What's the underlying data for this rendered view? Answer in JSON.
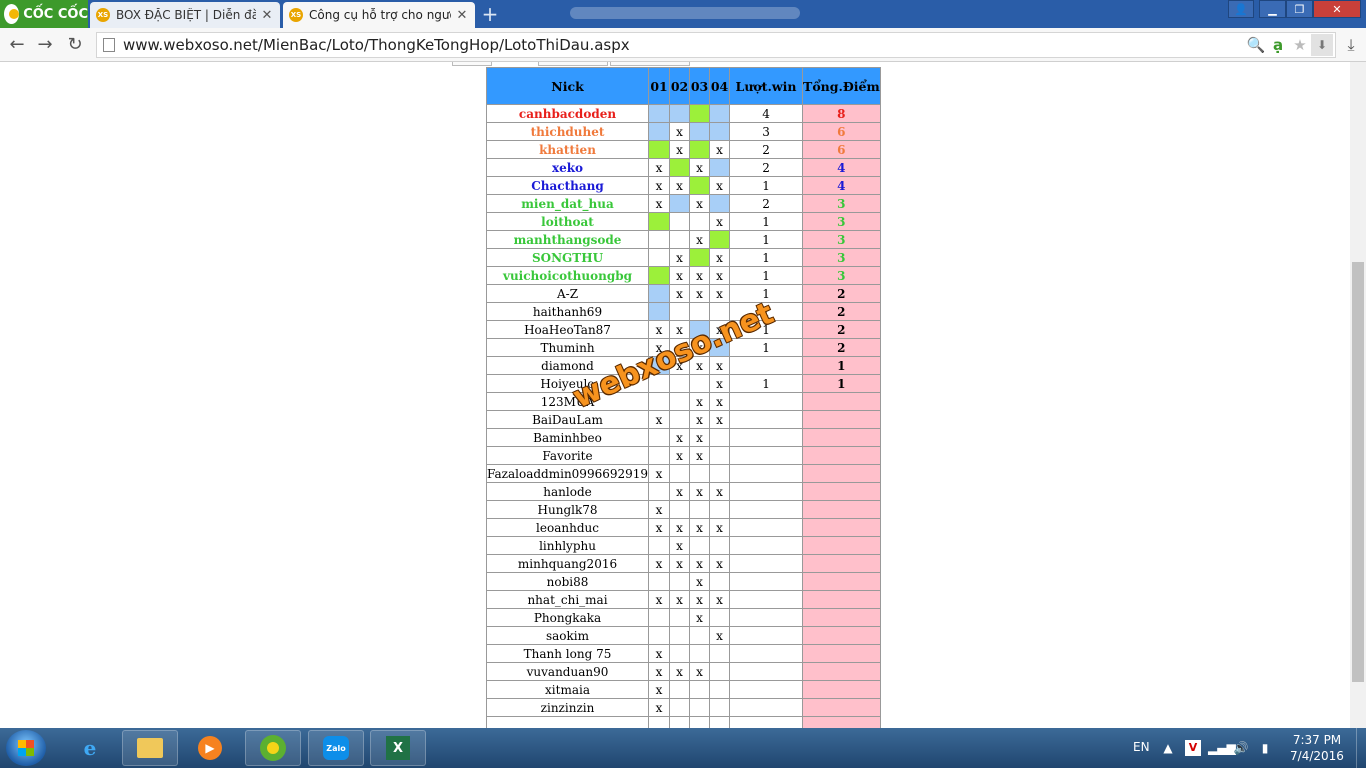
{
  "browser": {
    "brand": "CỐC CỐC",
    "tabs": [
      {
        "favicon": "XS",
        "title": "BOX ĐẶC BIỆT | Diễn đàn x",
        "active": false
      },
      {
        "favicon": "XS",
        "title": "Công cụ hỗ trợ cho người",
        "active": true
      }
    ],
    "url": "www.webxoso.net/MienBac/Loto/ThongKeTongHop/LotoThiDau.aspx"
  },
  "table": {
    "headers": [
      "Nick",
      "01",
      "02",
      "03",
      "04",
      "Lượt.win",
      "Tổng.Điểm"
    ],
    "rows": [
      {
        "nick": "canhbacdoden",
        "style": "red",
        "c": [
          "blue",
          "blue",
          "green",
          "blue"
        ],
        "wins": "4",
        "points": "8"
      },
      {
        "nick": "thichduhet",
        "style": "orange",
        "c": [
          "blue",
          "x",
          "blue",
          "blue"
        ],
        "wins": "3",
        "points": "6"
      },
      {
        "nick": "khattien",
        "style": "orange",
        "c": [
          "green",
          "x",
          "green",
          "x"
        ],
        "wins": "2",
        "points": "6"
      },
      {
        "nick": "xeko",
        "style": "navy",
        "c": [
          "x",
          "green",
          "x",
          "blue"
        ],
        "wins": "2",
        "points": "4"
      },
      {
        "nick": "Chacthang",
        "style": "navy",
        "c": [
          "x",
          "x",
          "green",
          "x"
        ],
        "wins": "1",
        "points": "4"
      },
      {
        "nick": "mien_dat_hua",
        "style": "lime",
        "c": [
          "x",
          "blue",
          "x",
          "blue"
        ],
        "wins": "2",
        "points": "3"
      },
      {
        "nick": "loithoat",
        "style": "lime",
        "c": [
          "green",
          "",
          "",
          "x"
        ],
        "wins": "1",
        "points": "3"
      },
      {
        "nick": "manhthangsode",
        "style": "lime",
        "c": [
          "",
          "",
          "x",
          "green"
        ],
        "wins": "1",
        "points": "3"
      },
      {
        "nick": "SONGTHU",
        "style": "lime",
        "c": [
          "",
          "x",
          "green",
          "x"
        ],
        "wins": "1",
        "points": "3"
      },
      {
        "nick": "vuichoicothuongbg",
        "style": "lime",
        "c": [
          "green",
          "x",
          "x",
          "x"
        ],
        "wins": "1",
        "points": "3"
      },
      {
        "nick": "A-Z",
        "style": "",
        "c": [
          "blue",
          "x",
          "x",
          "x"
        ],
        "wins": "1",
        "points": "2"
      },
      {
        "nick": "haithanh69",
        "style": "",
        "c": [
          "blue",
          "",
          "",
          ""
        ],
        "wins": "1",
        "points": "2"
      },
      {
        "nick": "HoaHeoTan87",
        "style": "",
        "c": [
          "x",
          "x",
          "blue",
          "x"
        ],
        "wins": "1",
        "points": "2"
      },
      {
        "nick": "Thuminh",
        "style": "",
        "c": [
          "x",
          "x",
          "x",
          "blue"
        ],
        "wins": "1",
        "points": "2"
      },
      {
        "nick": "diamond",
        "style": "",
        "c": [
          "blue",
          "x",
          "x",
          "x"
        ],
        "wins": "",
        "points": "1"
      },
      {
        "nick": "Hoiyeulo",
        "style": "",
        "c": [
          "",
          "",
          "",
          "x"
        ],
        "wins": "1",
        "points": "1"
      },
      {
        "nick": "123MUA",
        "style": "",
        "c": [
          "",
          "",
          "x",
          "x"
        ],
        "wins": "",
        "points": ""
      },
      {
        "nick": "BaiDauLam",
        "style": "",
        "c": [
          "x",
          "",
          "x",
          "x"
        ],
        "wins": "",
        "points": ""
      },
      {
        "nick": "Baminhbeo",
        "style": "",
        "c": [
          "",
          "x",
          "x",
          ""
        ],
        "wins": "",
        "points": ""
      },
      {
        "nick": "Favorite",
        "style": "",
        "c": [
          "",
          "x",
          "x",
          ""
        ],
        "wins": "",
        "points": ""
      },
      {
        "nick": "Fazaloaddmin0996692919",
        "style": "",
        "c": [
          "x",
          "",
          "",
          ""
        ],
        "wins": "",
        "points": ""
      },
      {
        "nick": "hanlode",
        "style": "",
        "c": [
          "",
          "x",
          "x",
          "x"
        ],
        "wins": "",
        "points": ""
      },
      {
        "nick": "Hunglk78",
        "style": "",
        "c": [
          "x",
          "",
          "",
          ""
        ],
        "wins": "",
        "points": ""
      },
      {
        "nick": "leoanhduc",
        "style": "",
        "c": [
          "x",
          "x",
          "x",
          "x"
        ],
        "wins": "",
        "points": ""
      },
      {
        "nick": "linhlyphu",
        "style": "",
        "c": [
          "",
          "x",
          "",
          ""
        ],
        "wins": "",
        "points": ""
      },
      {
        "nick": "minhquang2016",
        "style": "",
        "c": [
          "x",
          "x",
          "x",
          "x"
        ],
        "wins": "",
        "points": ""
      },
      {
        "nick": "nobi88",
        "style": "",
        "c": [
          "",
          "",
          "x",
          ""
        ],
        "wins": "",
        "points": ""
      },
      {
        "nick": "nhat_chi_mai",
        "style": "",
        "c": [
          "x",
          "x",
          "x",
          "x"
        ],
        "wins": "",
        "points": ""
      },
      {
        "nick": "Phongkaka",
        "style": "",
        "c": [
          "",
          "",
          "x",
          ""
        ],
        "wins": "",
        "points": ""
      },
      {
        "nick": "saokim",
        "style": "",
        "c": [
          "",
          "",
          "",
          "x"
        ],
        "wins": "",
        "points": ""
      },
      {
        "nick": "Thanh long 75",
        "style": "",
        "c": [
          "x",
          "",
          "",
          ""
        ],
        "wins": "",
        "points": ""
      },
      {
        "nick": "vuvanduan90",
        "style": "",
        "c": [
          "x",
          "x",
          "x",
          ""
        ],
        "wins": "",
        "points": ""
      },
      {
        "nick": "xitmaia",
        "style": "",
        "c": [
          "x",
          "",
          "",
          ""
        ],
        "wins": "",
        "points": ""
      },
      {
        "nick": "zinzinzin",
        "style": "",
        "c": [
          "x",
          "",
          "",
          ""
        ],
        "wins": "",
        "points": ""
      },
      {
        "nick": "",
        "style": "",
        "c": [
          "",
          "",
          "",
          ""
        ],
        "wins": "",
        "points": ""
      }
    ]
  },
  "watermark": "webxoso.net",
  "taskbar": {
    "language": "EN",
    "time": "7:37 PM",
    "date": "7/4/2016",
    "zalo_label": "Zalo",
    "excel_label": "X",
    "media_label": "▶"
  },
  "colors": {
    "header": "#3399ff",
    "points_bg": "#ffc0cb",
    "cell_blue": "#a8cff7",
    "cell_green": "#9cf03a"
  }
}
